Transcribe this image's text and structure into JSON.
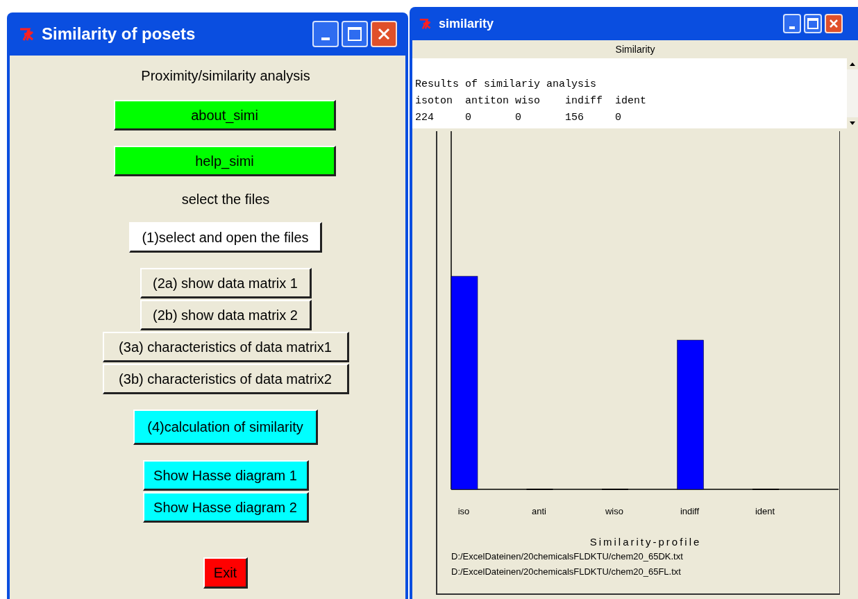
{
  "main_window": {
    "title": "Similarity of posets",
    "heading": "Proximity/similarity analysis",
    "items": [
      {
        "kind": "button",
        "label": "about_simi",
        "color": "#00ff00"
      },
      {
        "kind": "button",
        "label": "help_simi",
        "color": "#00ff00"
      },
      {
        "kind": "label",
        "label": "select the files"
      },
      {
        "kind": "button",
        "label": "(1)select and open the files",
        "color": "#ffffff"
      },
      {
        "kind": "button",
        "label": "(2a) show data matrix 1",
        "color": "#ece9d8"
      },
      {
        "kind": "button",
        "label": "(2b) show data matrix 2",
        "color": "#ece9d8"
      },
      {
        "kind": "button",
        "label": "(3a) characteristics of data matrix1",
        "color": "#ece9d8"
      },
      {
        "kind": "button",
        "label": "(3b) characteristics of data matrix2",
        "color": "#ece9d8"
      },
      {
        "kind": "button",
        "label": "(4)calculation of similarity",
        "color": "#00ffff"
      },
      {
        "kind": "button",
        "label": "Show Hasse diagram 1",
        "color": "#00ffff"
      },
      {
        "kind": "button",
        "label": "Show Hasse diagram 2",
        "color": "#00ffff"
      },
      {
        "kind": "button",
        "label": "Exit",
        "color": "#ff0000"
      }
    ]
  },
  "result_window": {
    "title": "similarity",
    "header": "Similarity",
    "output_lines": [
      "Results of similariy analysis",
      "isoton  antiton wiso    indiff  ident",
      "224     0       0       156     0"
    ],
    "chart": {
      "xlabel": "Similarity-profile",
      "categories": [
        "iso",
        "anti",
        "wiso",
        "indiff",
        "ident"
      ]
    },
    "files": [
      "D:/ExcelDateinen/20chemicalsFLDKTU/chem20_65DK.txt",
      "D:/ExcelDateinen/20chemicalsFLDKTU/chem20_65FL.txt"
    ]
  }
}
